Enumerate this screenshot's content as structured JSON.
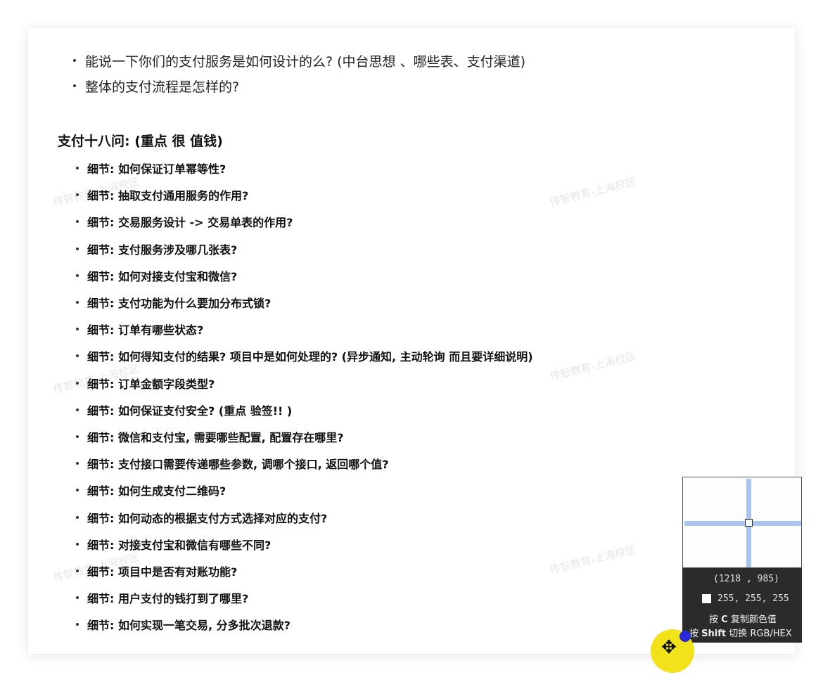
{
  "top_list": [
    "能说一下你们的支付服务是如何设计的么? (中台思想 、哪些表、支付渠道)",
    "整体的支付流程是怎样的?"
  ],
  "heading": "支付十八问: (重点  很  值钱)",
  "details": [
    "细节: 如何保证订单幂等性?",
    "细节: 抽取支付通用服务的作用?",
    "细节: 交易服务设计 -> 交易单表的作用?",
    "细节: 支付服务涉及哪几张表?",
    "细节: 如何对接支付宝和微信?",
    "细节: 支付功能为什么要加分布式锁?",
    "细节: 订单有哪些状态?",
    "细节: 如何得知支付的结果? 项目中是如何处理的? (异步通知, 主动轮询      而且要详细说明)",
    "细节: 订单金额字段类型?",
    "细节: 如何保证支付安全? (重点 验签!! )",
    "细节: 微信和支付宝, 需要哪些配置, 配置存在哪里?",
    "细节: 支付接口需要传递哪些参数, 调哪个接口, 返回哪个值?",
    "细节: 如何生成支付二维码?",
    "细节: 如何动态的根据支付方式选择对应的支付?",
    "细节: 对接支付宝和微信有哪些不同?",
    "细节: 项目中是否有对账功能?",
    "细节: 用户支付的钱打到了哪里?",
    "细节: 如何实现一笔交易, 分多批次退款?"
  ],
  "watermark": "传智教育-上海校区",
  "picker": {
    "coords": "(1218 , 985)",
    "rgb": "255, 255, 255",
    "hint_copy_pre": "按 ",
    "hint_copy_key": "C",
    "hint_copy_post": " 复制颜色值",
    "hint_switch_pre": "按 ",
    "hint_switch_key": "Shift",
    "hint_switch_post": " 切换 RGB/HEX"
  },
  "colors": {
    "crosshair": "#a9c4f0",
    "cursor_halo": "#f1e21a",
    "cursor_dot": "#2a2ad8"
  }
}
